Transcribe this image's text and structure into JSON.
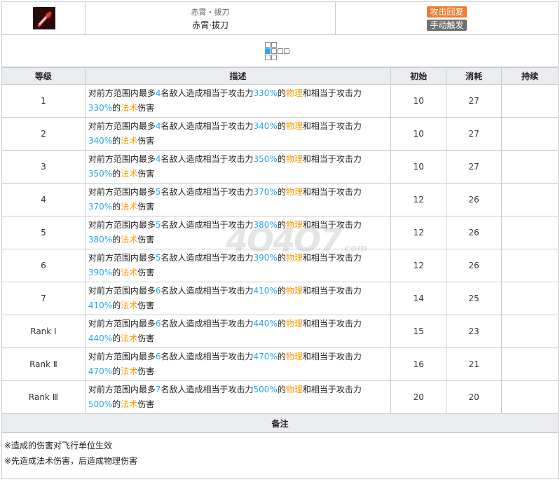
{
  "skill": {
    "subtitle": "赤霄・拔刀",
    "name": "赤霄·拔刀",
    "tags": [
      "攻击回复",
      "手动触发"
    ],
    "colors": {
      "tag_recover": "#f27b32",
      "tag_trigger": "#707070",
      "range_self": "#27a6f3",
      "highlight_blue": "#27a6f3",
      "highlight_orange": "#ff9900"
    },
    "icon": "skill-sword-icon"
  },
  "table": {
    "headers": [
      "等级",
      "描述",
      "初始",
      "消耗",
      "持续"
    ],
    "rows": [
      {
        "level": "1",
        "enemies": "4",
        "atk1": "330%",
        "phys": "物理",
        "atk2": "330%",
        "arts": "法术",
        "init": "10",
        "cost": "27",
        "dur": ""
      },
      {
        "level": "2",
        "enemies": "4",
        "atk1": "340%",
        "phys": "物理",
        "atk2": "340%",
        "arts": "法术",
        "init": "10",
        "cost": "27",
        "dur": ""
      },
      {
        "level": "3",
        "enemies": "4",
        "atk1": "350%",
        "phys": "物理",
        "atk2": "350%",
        "arts": "法术",
        "init": "10",
        "cost": "27",
        "dur": ""
      },
      {
        "level": "4",
        "enemies": "5",
        "atk1": "370%",
        "phys": "物理",
        "atk2": "370%",
        "arts": "法术",
        "init": "12",
        "cost": "26",
        "dur": ""
      },
      {
        "level": "5",
        "enemies": "5",
        "atk1": "380%",
        "phys": "物理",
        "atk2": "380%",
        "arts": "法术",
        "init": "12",
        "cost": "26",
        "dur": ""
      },
      {
        "level": "6",
        "enemies": "5",
        "atk1": "390%",
        "phys": "物理",
        "atk2": "390%",
        "arts": "法术",
        "init": "12",
        "cost": "26",
        "dur": ""
      },
      {
        "level": "7",
        "enemies": "6",
        "atk1": "410%",
        "phys": "物理",
        "atk2": "410%",
        "arts": "法术",
        "init": "14",
        "cost": "25",
        "dur": ""
      },
      {
        "level": "Rank Ⅰ",
        "enemies": "6",
        "atk1": "440%",
        "phys": "物理",
        "atk2": "440%",
        "arts": "法术",
        "init": "15",
        "cost": "23",
        "dur": ""
      },
      {
        "level": "Rank Ⅱ",
        "enemies": "6",
        "atk1": "470%",
        "phys": "物理",
        "atk2": "470%",
        "arts": "法术",
        "init": "16",
        "cost": "21",
        "dur": ""
      },
      {
        "level": "Rank Ⅲ",
        "enemies": "7",
        "atk1": "500%",
        "phys": "物理",
        "atk2": "500%",
        "arts": "法术",
        "init": "20",
        "cost": "20",
        "dur": ""
      }
    ],
    "desc_parts": {
      "p1": "对前方范围内最多",
      "p2": "名敌人造成相当于攻击力",
      "p3": "的",
      "p4": "和相当于攻击力",
      "p5": "的",
      "p6": "伤害"
    }
  },
  "notes": {
    "title": "备注",
    "lines": [
      "※造成的伤害对飞行单位生效",
      "※先造成法术伤害，后造成物理伤害"
    ]
  },
  "watermark": {
    "main": "4O4O7",
    "suffix": ".com"
  }
}
